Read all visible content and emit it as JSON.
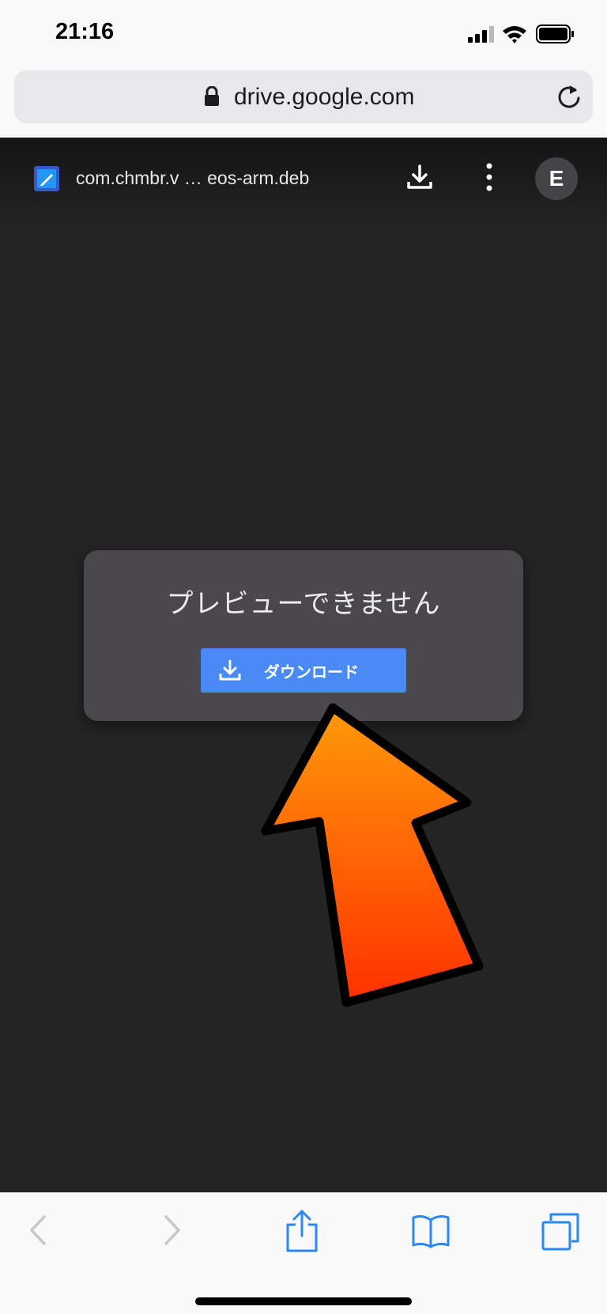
{
  "status_bar": {
    "time": "21:16"
  },
  "safari": {
    "url": "drive.google.com"
  },
  "drive_header": {
    "file_name": "com.chmbr.v … eos-arm.deb",
    "avatar_letter": "E"
  },
  "viewer": {
    "message": "プレビューできません",
    "download_label": "ダウンロード"
  },
  "colors": {
    "accent_blue": "#4a8af4",
    "card_bg": "#4a484c",
    "viewer_bg": "#242424",
    "arrow_top": "#ff9a0a",
    "arrow_bottom": "#ff3000",
    "ios_blue": "#2a87f7"
  }
}
